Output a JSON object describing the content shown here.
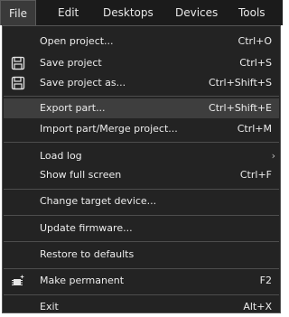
{
  "menubar": {
    "items": [
      "File",
      "Edit",
      "Desktops",
      "Devices",
      "Tools"
    ]
  },
  "menu": {
    "open_project": {
      "label": "Open project...",
      "shortcut": "Ctrl+O"
    },
    "save_project": {
      "label": "Save project",
      "shortcut": "Ctrl+S",
      "icon": "floppy-disk-icon"
    },
    "save_project_as": {
      "label": "Save project as...",
      "shortcut": "Ctrl+Shift+S",
      "icon": "floppy-disk-icon"
    },
    "export_part": {
      "label": "Export part...",
      "shortcut": "Ctrl+Shift+E"
    },
    "import_merge": {
      "label": "Import part/Merge project...",
      "shortcut": "Ctrl+M"
    },
    "load_log": {
      "label": "Load log",
      "submenu": "›"
    },
    "full_screen": {
      "label": "Show full screen",
      "shortcut": "Ctrl+F"
    },
    "change_target": {
      "label": "Change target device..."
    },
    "update_firmware": {
      "label": "Update firmware..."
    },
    "restore_defaults": {
      "label": "Restore to defaults"
    },
    "make_permanent": {
      "label": "Make permanent",
      "shortcut": "F2",
      "icon": "chip-sparkle-icon"
    },
    "exit": {
      "label": "Exit",
      "shortcut": "Alt+X"
    }
  },
  "colors": {
    "menubar_bg": "#1b1b1b",
    "menu_bg": "#232323",
    "highlight": "#3e3e3e",
    "separator": "#4d4d4d",
    "text": "#ececec"
  }
}
